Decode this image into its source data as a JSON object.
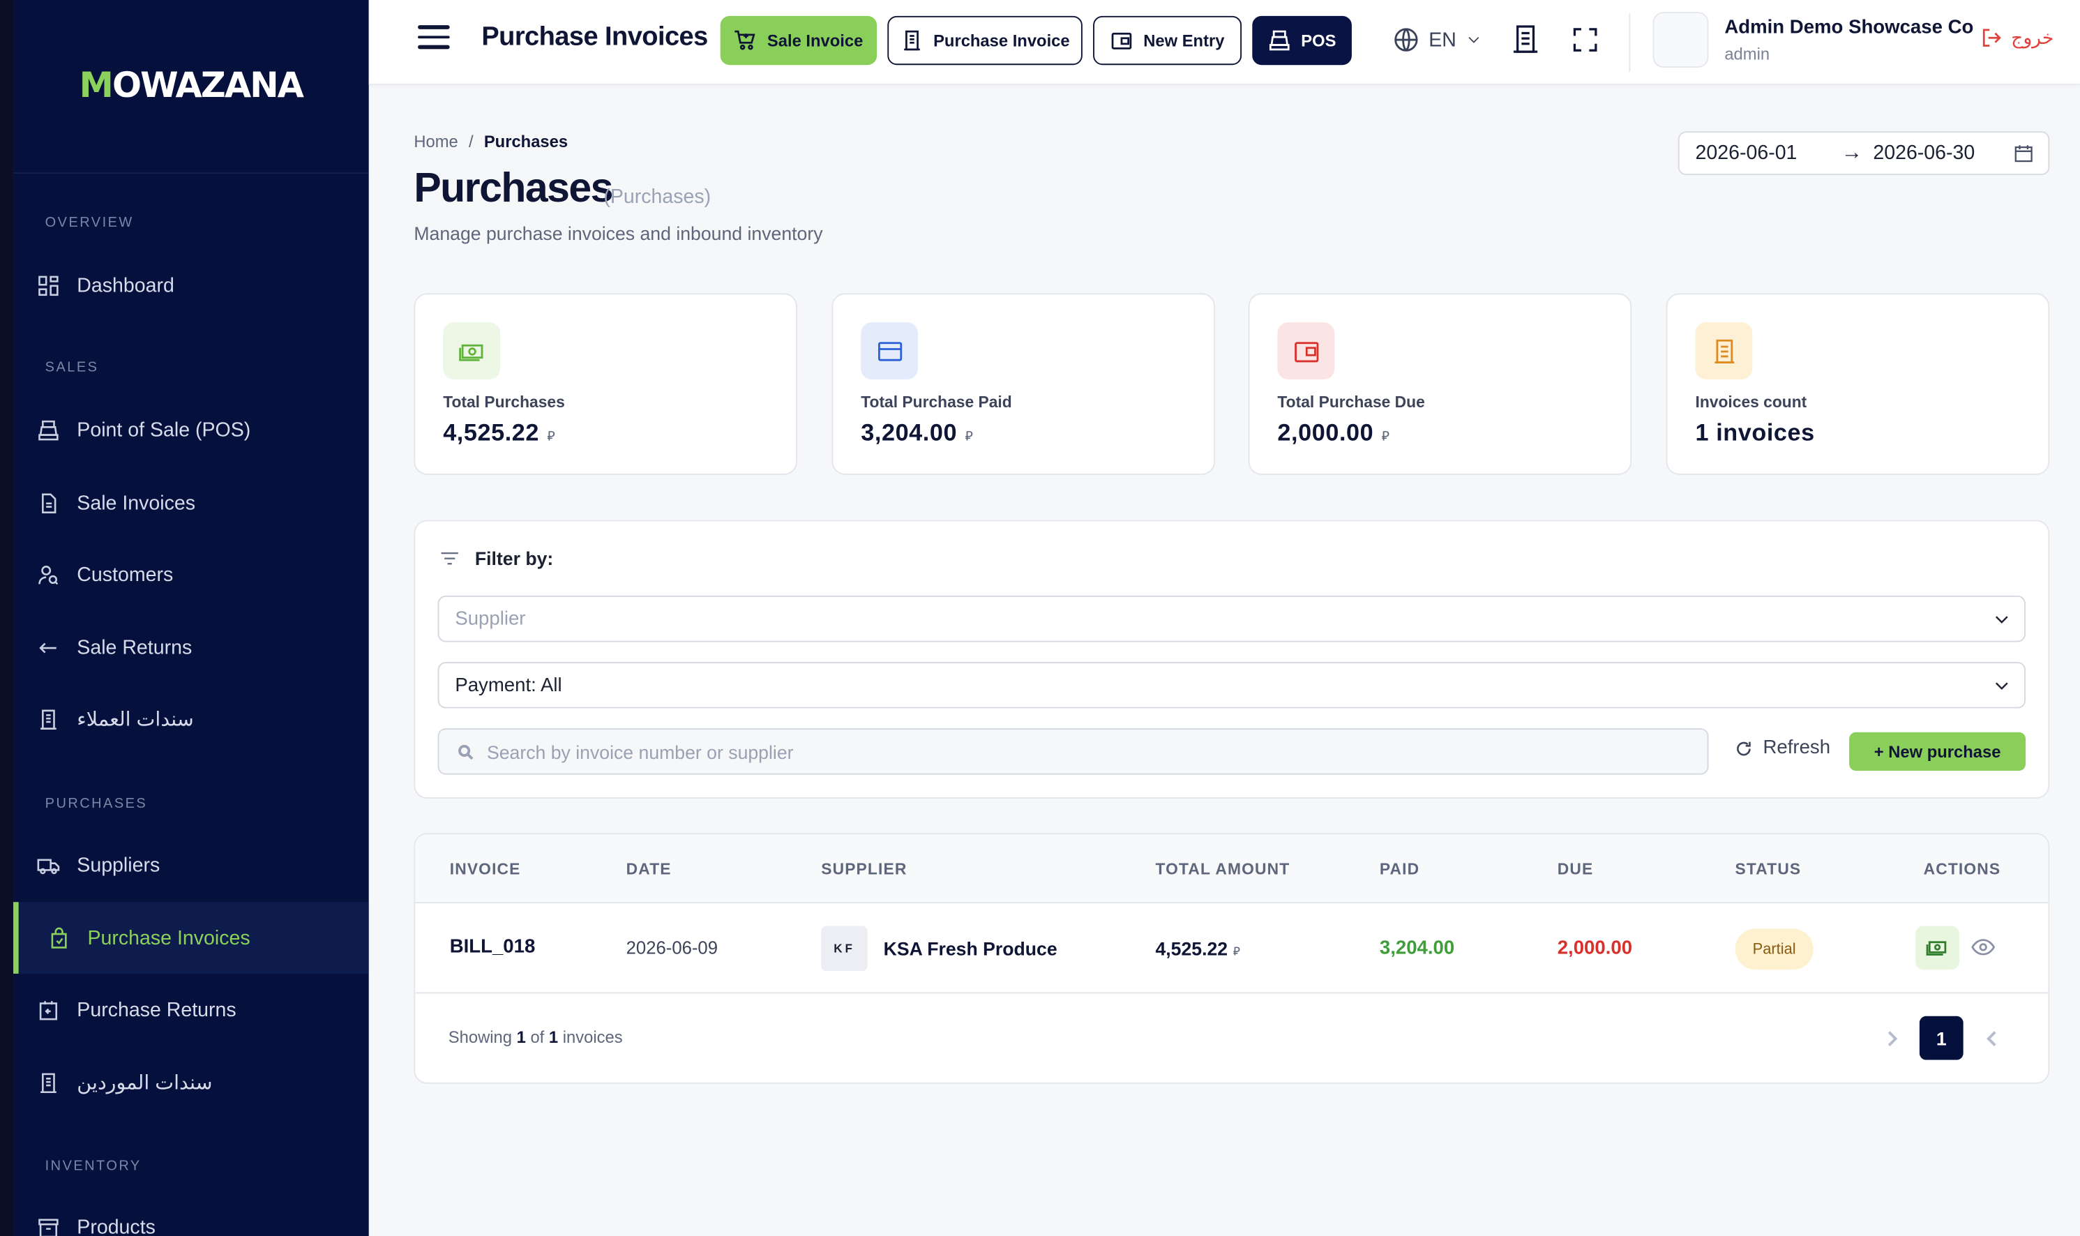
{
  "brand": {
    "logo": "MOWAZANA"
  },
  "topbar": {
    "title": "Purchase Invoices",
    "buttons": {
      "sale_invoice": "Sale Invoice",
      "purchase_invoice": "Purchase Invoice",
      "new_entry": "New Entry",
      "pos": "POS"
    },
    "lang": "EN",
    "user_name": "Admin Demo Showcase Co",
    "user_role": "admin",
    "logout": "خروج"
  },
  "sidebar": {
    "sections": {
      "overview": "OVERVIEW",
      "sales": "SALES",
      "purchases": "PURCHASES",
      "inventory": "INVENTORY"
    },
    "items": {
      "dashboard": "Dashboard",
      "pos": "Point of Sale (POS)",
      "sale_invoices": "Sale Invoices",
      "customers": "Customers",
      "sale_returns": "Sale Returns",
      "customer_vouchers": "سندات العملاء",
      "suppliers": "Suppliers",
      "purchase_invoices": "Purchase Invoices",
      "purchase_returns": "Purchase Returns",
      "supplier_vouchers": "سندات الموردين",
      "products": "Products"
    },
    "active": "purchase_invoices"
  },
  "breadcrumb": {
    "home": "Home",
    "separator": "/",
    "current": "Purchases"
  },
  "page": {
    "title": "Purchases",
    "subtitle": "(Purchases)",
    "description": "Manage purchase invoices and inbound inventory"
  },
  "date_range": {
    "from": "2026-06-01",
    "arrow": "→",
    "to": "2026-06-30"
  },
  "stats": {
    "total_purchases": {
      "label": "Total Purchases",
      "value": "4,525.22",
      "currency": "⃁"
    },
    "total_paid": {
      "label": "Total Purchase Paid",
      "value": "3,204.00",
      "currency": "⃁"
    },
    "total_due": {
      "label": "Total Purchase Due",
      "value": "2,000.00",
      "currency": "⃁"
    },
    "invoices_count": {
      "label": "Invoices count",
      "value": "1 invoices"
    }
  },
  "filters": {
    "heading": "Filter by:",
    "supplier_placeholder": "Supplier",
    "payment_value": "Payment: All",
    "search_placeholder": "Search by invoice number or supplier",
    "refresh": "Refresh",
    "new_purchase": "+ New purchase"
  },
  "table": {
    "headers": {
      "invoice": "INVOICE",
      "date": "DATE",
      "supplier": "SUPPLIER",
      "total": "TOTAL AMOUNT",
      "paid": "PAID",
      "due": "DUE",
      "status": "STATUS",
      "actions": "ACTIONS"
    },
    "rows": [
      {
        "invoice": "BILL_018",
        "date": "2026-06-09",
        "supplier_initials": "KF",
        "supplier": "KSA Fresh Produce",
        "total": "4,525.22",
        "currency": "⃁",
        "paid": "3,204.00",
        "due": "2,000.00",
        "status": "Partial"
      }
    ],
    "footer": {
      "prefix": "Showing ",
      "shown": "1",
      "of": " of ",
      "total": "1",
      "suffix": " invoices"
    },
    "pagination": {
      "current": "1"
    }
  },
  "colors": {
    "accent_green": "#8bcf5b",
    "sidebar_bg": "#06103d",
    "paid_green": "#3f9e3a",
    "due_red": "#d8312b",
    "partial_badge": "#fdf1cf"
  }
}
